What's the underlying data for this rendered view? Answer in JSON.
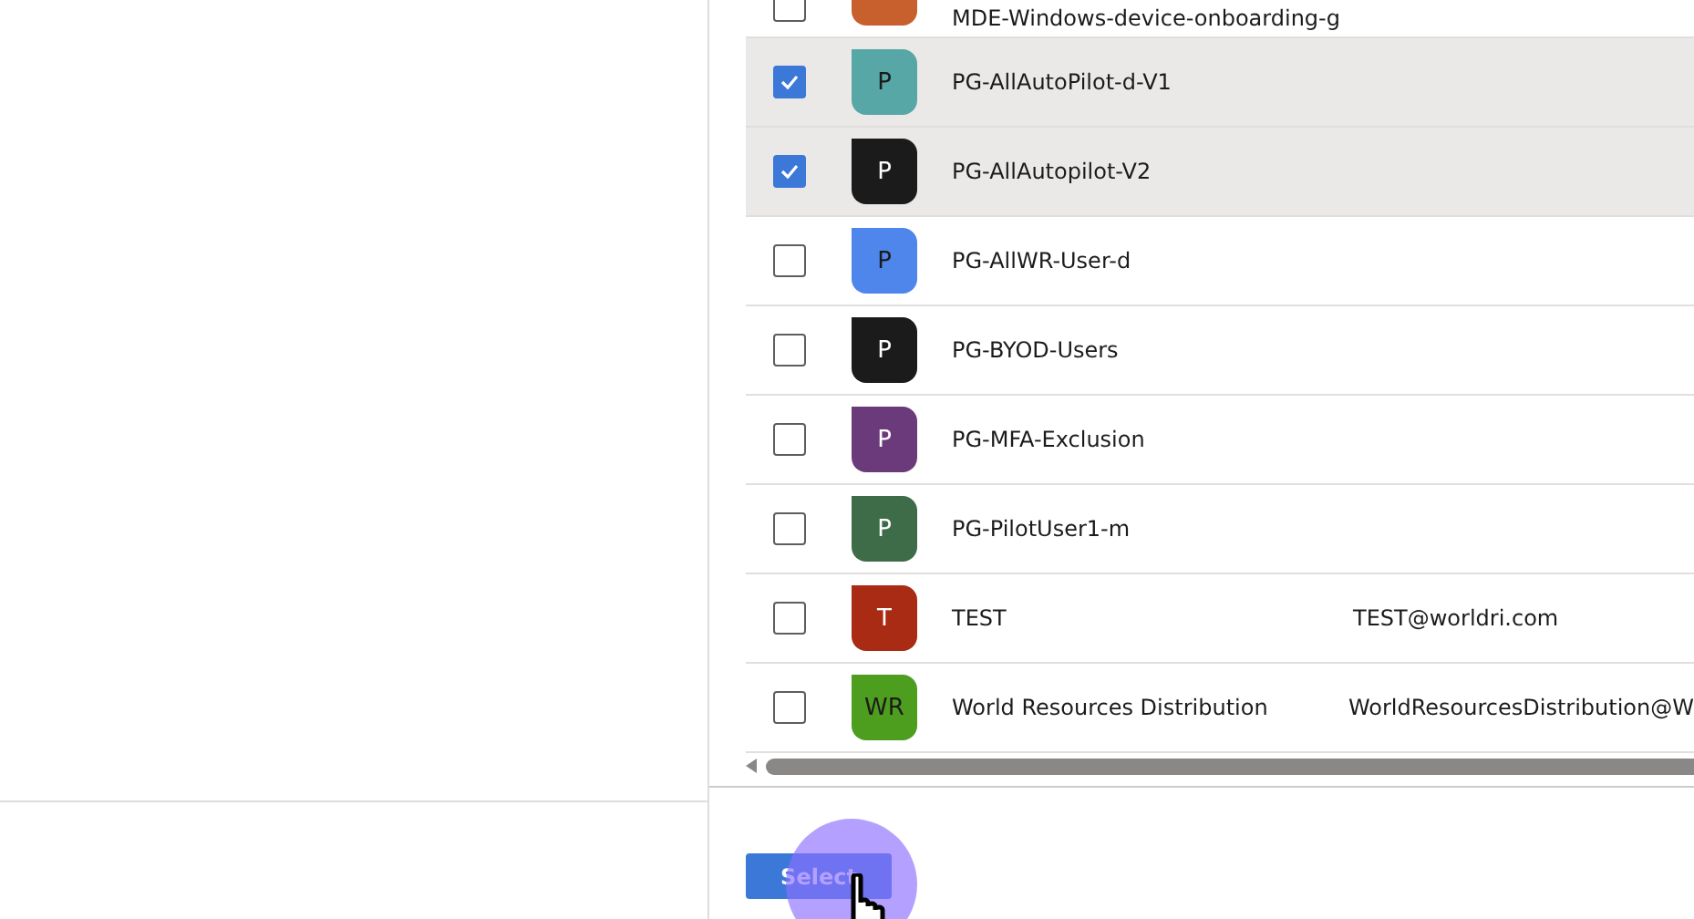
{
  "table": {
    "rows": [
      {
        "name": "MDE-Windows-device-onboarding-g",
        "checked": false,
        "color": "#c8602e"
      },
      {
        "initials": "P",
        "name": "PG-AllAutoPilot-d-V1",
        "checked": true,
        "color": "#56a7a5"
      },
      {
        "initials": "P",
        "name": "PG-AllAutopilot-V2",
        "checked": true,
        "color": "#1b1b1b"
      },
      {
        "initials": "P",
        "name": "PG-AllWR-User-d",
        "checked": false,
        "color": "#4f86ec"
      },
      {
        "initials": "P",
        "name": "PG-BYOD-Users",
        "checked": false,
        "color": "#1b1b1b"
      },
      {
        "initials": "P",
        "name": "PG-MFA-Exclusion",
        "checked": false,
        "color": "#6b3a7a"
      },
      {
        "initials": "P",
        "name": "PG-PilotUser1-m",
        "checked": false,
        "color": "#3e6b48"
      },
      {
        "initials": "T",
        "name": "TEST",
        "email": "TEST@worldri.com",
        "checked": false,
        "color": "#a92b14"
      },
      {
        "initials": "WR",
        "name": "World Resources Distribution",
        "email": "WorldResourcesDistribution@W",
        "checked": false,
        "color": "#4d9e1f"
      }
    ]
  },
  "footer": {
    "button": "Select"
  }
}
